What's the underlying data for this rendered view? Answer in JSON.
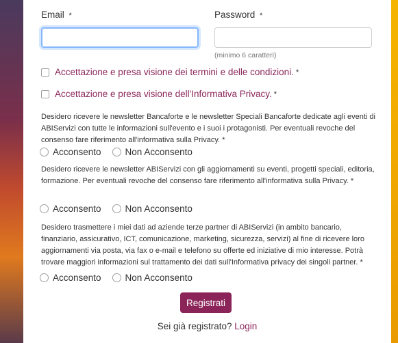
{
  "form": {
    "email_label": "Email",
    "password_label": "Password",
    "required_mark": "*",
    "password_hint": "(minimo 6 caratteri)",
    "email_value": "",
    "password_value": ""
  },
  "checkboxes": {
    "terms_label": "Accettazione e presa visione dei termini e delle condizioni.",
    "privacy_label": "Accettazione e presa visione dell'Informativa Privacy."
  },
  "consents": [
    {
      "text": "Desidero ricevere le newsletter Bancaforte e le newsletter Speciali Bancaforte dedicate agli eventi di ABIServizi con tutte le informazioni sull'evento e i suoi i protagonisti. Per eventuali revoche del consenso fare riferimento all'informativa sulla Privacy. *",
      "yes": "Acconsento",
      "no": "Non Acconsento"
    },
    {
      "text": "Desidero ricevere le newsletter ABIServizi con gli aggiornamenti su eventi, progetti speciali, editoria, formazione. Per eventuali revoche del consenso fare riferimento all'informativa sulla Privacy. *",
      "yes": "Acconsento",
      "no": "Non Acconsento"
    },
    {
      "text": "Desidero trasmettere i miei dati ad aziende terze partner di ABIServizi (in ambito bancario, finanziario, assicurativo, ICT, comunicazione, marketing, sicurezza, servizi) al fine di ricevere loro aggiornamenti via posta, via fax o e-mail e telefono su offerte ed iniziative di mio interesse. Potrà trovare maggiori informazioni sul trattamento dei dati sull'Informativa privacy dei singoli partner. *",
      "yes": "Acconsento",
      "no": "Non Acconsento"
    }
  ],
  "submit_label": "Registrati",
  "login": {
    "prompt": "Sei già registrato?",
    "link": "Login"
  },
  "colors": {
    "accent": "#8b2559",
    "background": "#f5b400"
  }
}
